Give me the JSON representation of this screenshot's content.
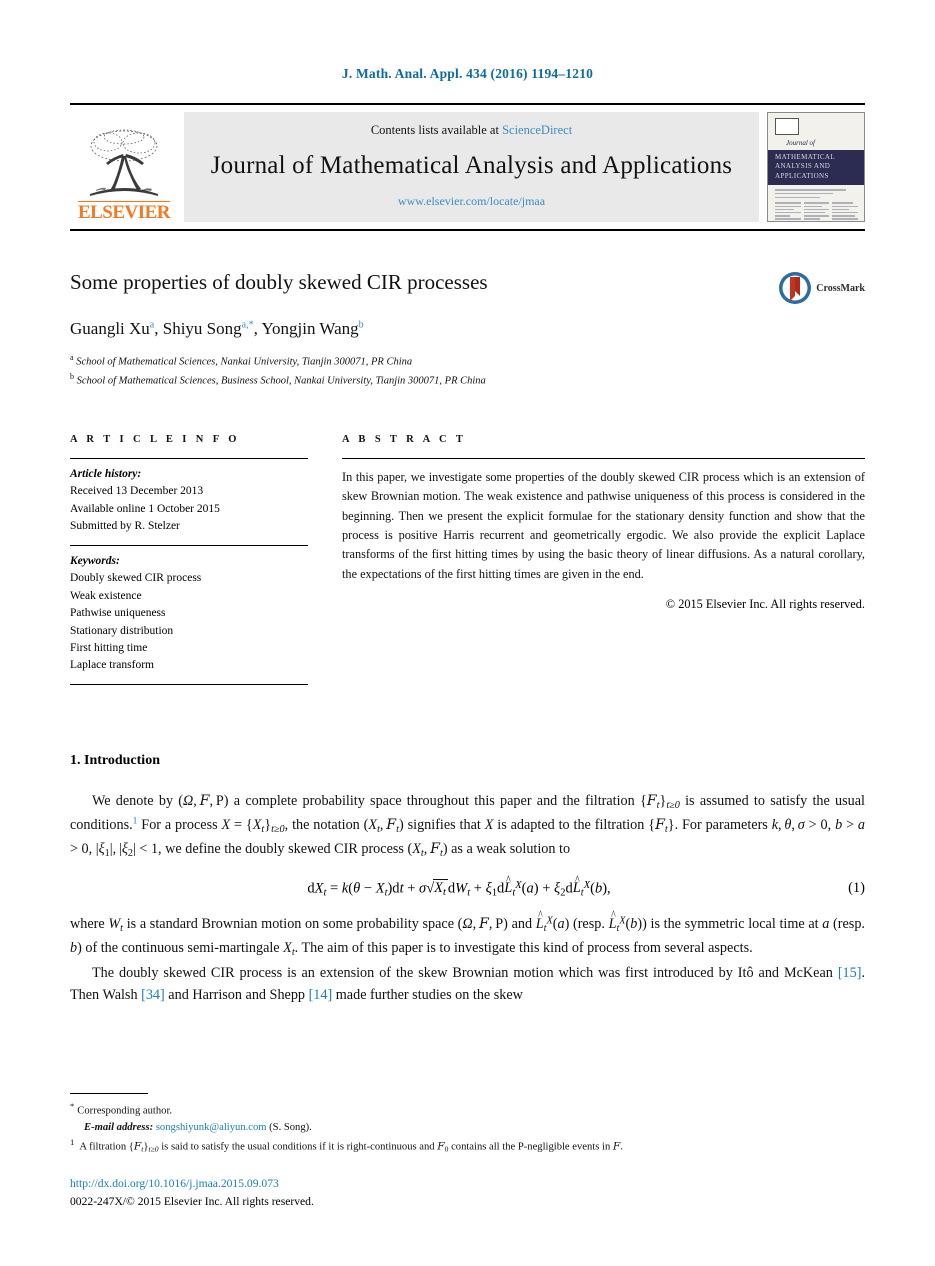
{
  "running_head": "J. Math. Anal. Appl. 434 (2016) 1194–1210",
  "masthead": {
    "contents_prefix": "Contents lists available at",
    "sciencedirect": "ScienceDirect",
    "journal_title": "Journal of Mathematical Analysis and Applications",
    "journal_url": "www.elsevier.com/locate/jmaa",
    "publisher_wordmark": "ELSEVIER",
    "cover": {
      "journal_of": "Journal of",
      "band_line1": "MATHEMATICAL",
      "band_line2": "ANALYSIS AND",
      "band_line3": "APPLICATIONS"
    }
  },
  "article": {
    "title": "Some properties of doubly skewed CIR processes",
    "authors_plain": "Guangli Xu",
    "author1": "Guangli Xu",
    "author1_mark": "a",
    "author2": "Shiyu Song",
    "author2_mark": "a,*",
    "author3": "Yongjin Wang",
    "author3_mark": "b",
    "affiliation_a_mark": "a",
    "affiliation_a": "School of Mathematical Sciences, Nankai University, Tianjin 300071, PR China",
    "affiliation_b_mark": "b",
    "affiliation_b": "School of Mathematical Sciences, Business School, Nankai University, Tianjin 300071, PR China",
    "crossmark_label": "CrossMark"
  },
  "info": {
    "heading": "A R T I C L E   I N F O",
    "history_label": "Article history:",
    "history": [
      "Received 13 December 2013",
      "Available online 1 October 2015",
      "Submitted by R. Stelzer"
    ],
    "keywords_label": "Keywords:",
    "keywords": [
      "Doubly skewed CIR process",
      "Weak existence",
      "Pathwise uniqueness",
      "Stationary distribution",
      "First hitting time",
      "Laplace transform"
    ]
  },
  "abstract": {
    "heading": "A B S T R A C T",
    "text": "In this paper, we investigate some properties of the doubly skewed CIR process which is an extension of skew Brownian motion. The weak existence and pathwise uniqueness of this process is considered in the beginning. Then we present the explicit formulae for the stationary density function and show that the process is positive Harris recurrent and geometrically ergodic. We also provide the explicit Laplace transforms of the first hitting times by using the basic theory of linear diffusions. As a natural corollary, the expectations of the first hitting times are given in the end.",
    "copyright": "© 2015 Elsevier Inc. All rights reserved."
  },
  "body": {
    "section_number_title": "1. Introduction",
    "para1_a": "We denote by (Ω, ",
    "para1_b": ", P) a complete probability space throughout this paper and the filtration {",
    "para1_footnote_mark": "1",
    "para2_text": "the symmetric local time at a (resp. b) of the continuous semi-martingale X",
    "equation_number": "(1)",
    "para3_lead": "The doubly skewed CIR process is an extension of the skew Brownian motion which was first introduced by Itô and McKean",
    "ref_15": "[15]",
    "para3_mid": ". Then Walsh",
    "ref_34": "[34]",
    "para3_mid2": "and Harrison and Shepp",
    "ref_14": "[14]",
    "para3_end": "made further studies on the skew"
  },
  "footnotes": {
    "corresponding_mark": "*",
    "corresponding": "Corresponding author.",
    "email_label": "E-mail address:",
    "email": "songshiyunk@aliyun.com",
    "email_suffix": "(S. Song).",
    "fn1_mark": "1",
    "doi": "http://dx.doi.org/10.1016/j.jmaa.2015.09.073",
    "issn_line": "0022-247X/© 2015 Elsevier Inc. All rights reserved."
  },
  "colors": {
    "link_blue": "#1a7fb5",
    "header_blue": "#0d6ba3",
    "elsevier_orange": "#F47920",
    "cover_navy": "#2c2c52"
  }
}
